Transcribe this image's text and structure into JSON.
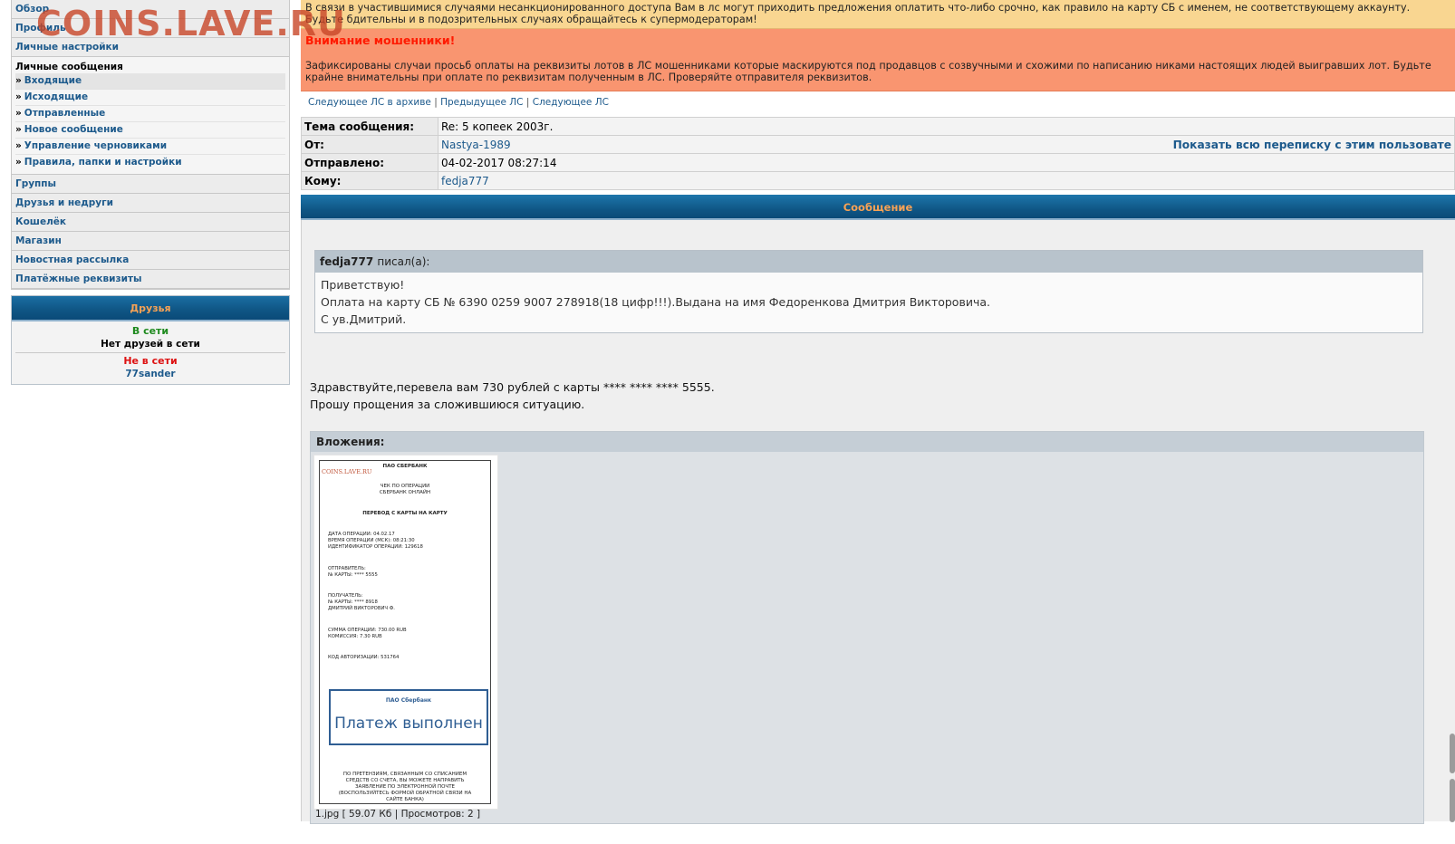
{
  "watermark": "COINS.LAVE.RU",
  "sidebar": {
    "top_links": [
      "Обзор",
      "Профиль",
      "Личные настройки"
    ],
    "pm_section_title": "Личные сообщения",
    "pm_items": [
      "Входящие",
      "Исходящие",
      "Отправленные",
      "Новое сообщение",
      "Управление черновиками",
      "Правила, папки и настройки"
    ],
    "bottom_links": [
      "Группы",
      "Друзья и недруги",
      "Кошелёк",
      "Магазин",
      "Новостная рассылка",
      "Платёжные реквизиты"
    ]
  },
  "friends": {
    "title": "Друзья",
    "online_label": "В сети",
    "online_empty": "Нет друзей в сети",
    "offline_label": "Не в сети",
    "offline_users": [
      "77sander"
    ]
  },
  "warnings": {
    "access_notice": "В связи в участившимися случаями несанкционированного доступа Вам в лс могут приходить предложения оплатить что-либо срочно, как правило на карту СБ с именем, не соответствующему аккаунту. Будьте бдительны и в подозрительных случаях обращайтесь к супермодераторам!",
    "fraud_title": "Внимание мошенники!",
    "fraud_text": "Зафиксированы случаи просьб оплаты на реквизиты лотов в ЛС мошенниками которые маскируются под продавцов с созвучными и схожими по написанию никами настоящих людей выигравших лот. Будьте крайне внимательны при оплате по реквизитам полученным в ЛС. Проверяйте отправителя реквизитов."
  },
  "nav": {
    "archive_next": "Следующее ЛС в архиве",
    "prev": "Предыдущее ЛС",
    "next": "Следующее ЛС",
    "sep": "|"
  },
  "meta": {
    "subject_label": "Тема сообщения:",
    "subject": "Re: 5 копеек 2003г.",
    "from_label": "От:",
    "from": "Nastya-1989",
    "show_all": "Показать всю переписку с этим пользовате",
    "sent_label": "Отправлено:",
    "sent": "04-02-2017 08:27:14",
    "to_label": "Кому:",
    "to": "fedja777"
  },
  "message": {
    "header": "Сообщение",
    "quote_author": "fedja777",
    "quote_wrote": "писал(а):",
    "quote_lines": [
      "Приветствую!",
      "Оплата на карту СБ № 6390 0259 9007 278918(18 цифр!!!).Выдана на имя Федоренкова Дмитрия Викторовича.",
      "С ув.Дмитрий."
    ],
    "reply_lines": [
      "Здравствуйте,перевела вам 730 рублей с карты **** **** **** 5555.",
      "Прошу прощения за сложившиюся ситуацию."
    ]
  },
  "attachments": {
    "title": "Вложения:",
    "file_info": "1.jpg [ 59.07 Кб | Просмотров: 2 ]",
    "receipt": {
      "logo": "COINS.LAVE.RU",
      "bank": "ПАО СБЕРБАНК",
      "check_line1": "ЧЕК ПО ОПЕРАЦИИ",
      "check_line2": "СБЕРБАНК ОНЛАЙН",
      "op_title": "ПЕРЕВОД С КАРТЫ НА КАРТУ",
      "date": "ДАТА ОПЕРАЦИИ: 04.02.17",
      "time": "ВРЕМЯ ОПЕРАЦИИ (МСК): 08:21:30",
      "op_id": "ИДЕНТИФИКАТОР ОПЕРАЦИИ: 129618",
      "sender_label": "ОТПРАВИТЕЛЬ:",
      "sender_card": "№ КАРТЫ: **** 5555",
      "recipient_label": "ПОЛУЧАТЕЛЬ:",
      "recipient_card": "№ КАРТЫ: **** 8918",
      "recipient_name": "ДМИТРИЙ ВИКТОРОВИЧ Ф.",
      "amount": "СУММА ОПЕРАЦИИ: 730.00 RUB",
      "fee": "КОМИССИЯ: 7.30 RUB",
      "auth_code": "КОД АВТОРИЗАЦИИ: 531764",
      "stamp_bank": "ПАО Сбербанк",
      "stamp_status": "Платеж выполнен",
      "footer_lines": [
        "ПО ПРЕТЕНЗИЯМ, СВЯЗАННЫМ СО СПИСАНИЕМ",
        "СРЕДСТВ СО СЧЕТА, ВЫ МОЖЕТЕ НАПРАВИТЬ",
        "ЗАЯВЛЕНИЕ ПО ЭЛЕКТРОННОЙ ПОЧТЕ",
        "(ВОСПОЛЬЗУЙТЕСЬ ФОРМОЙ ОБРАТНОЙ СВЯЗИ НА",
        "САЙТЕ БАНКА)"
      ]
    }
  }
}
